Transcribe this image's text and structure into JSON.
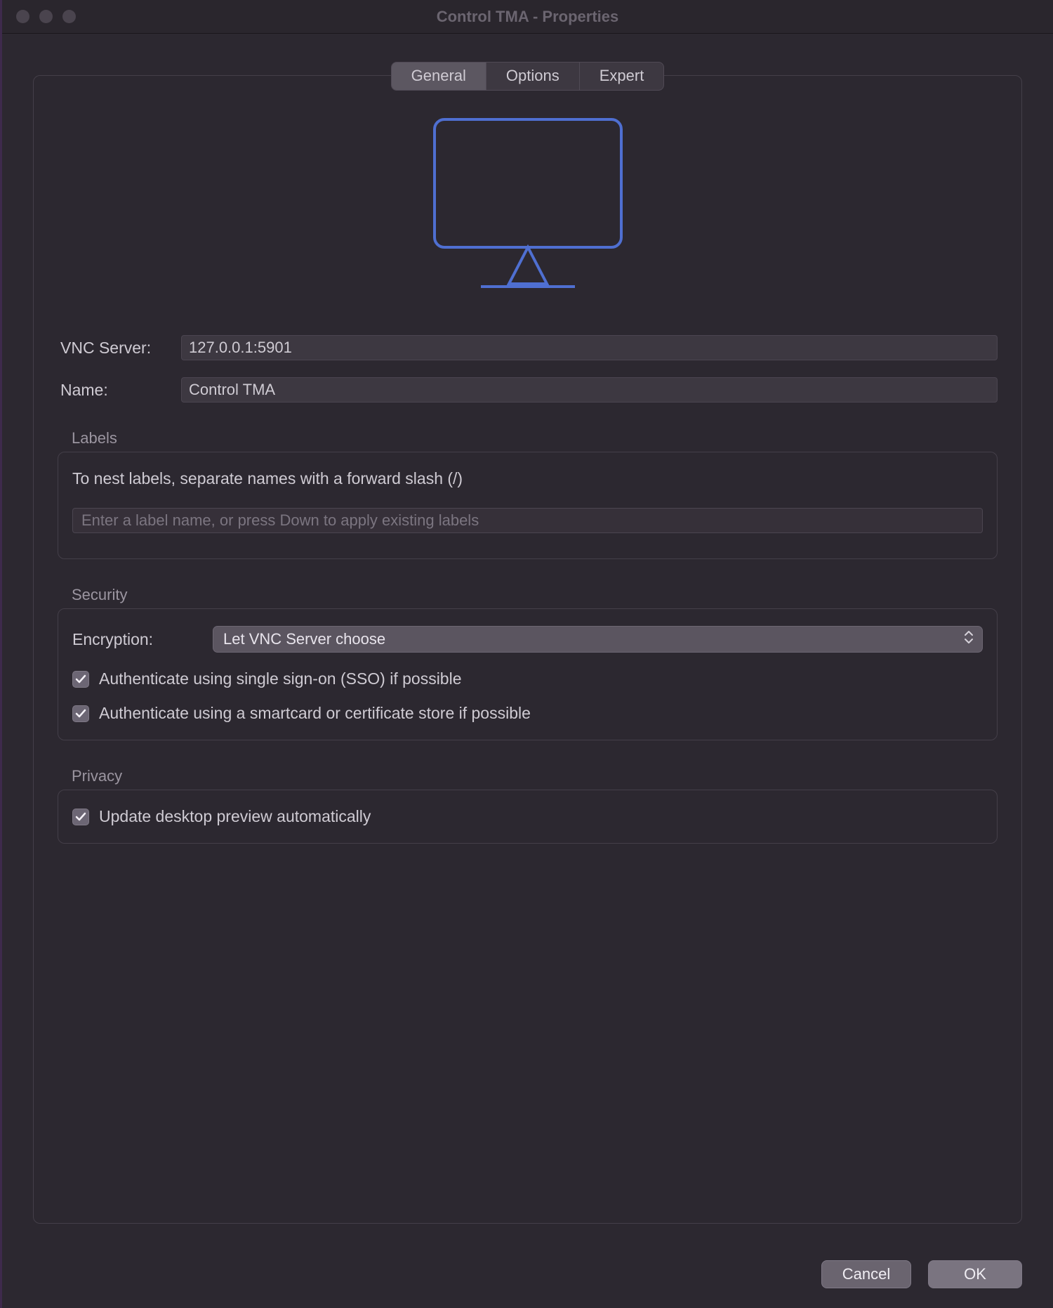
{
  "window": {
    "title": "Control TMA - Properties"
  },
  "tabs": {
    "general": "General",
    "options": "Options",
    "expert": "Expert",
    "selected": "General"
  },
  "icon": {
    "color": "#4f6fd1"
  },
  "form": {
    "vnc_server_label": "VNC Server:",
    "vnc_server_value": "127.0.0.1:5901",
    "name_label": "Name:",
    "name_value": "Control TMA"
  },
  "labels_group": {
    "title": "Labels",
    "hint": "To nest labels, separate names with a forward slash (/)",
    "placeholder": "Enter a label name, or press Down to apply existing labels",
    "value": ""
  },
  "security_group": {
    "title": "Security",
    "encryption_label": "Encryption:",
    "encryption_value": "Let VNC Server choose",
    "sso_checked": true,
    "sso_label": "Authenticate using single sign-on (SSO) if possible",
    "smartcard_checked": true,
    "smartcard_label": "Authenticate using a smartcard or certificate store if possible"
  },
  "privacy_group": {
    "title": "Privacy",
    "preview_checked": true,
    "preview_label": "Update desktop preview automatically"
  },
  "footer": {
    "cancel": "Cancel",
    "ok": "OK"
  }
}
